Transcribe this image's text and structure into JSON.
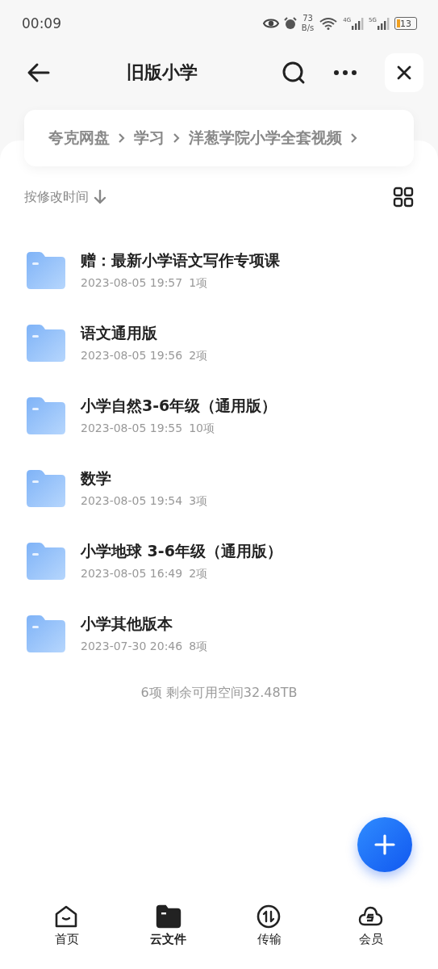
{
  "status_bar": {
    "time": "00:09",
    "net_speed": "73",
    "net_unit": "B/s",
    "sig1": "4G",
    "sig2": "5G",
    "battery": "13"
  },
  "header": {
    "title": "旧版小学"
  },
  "breadcrumb": [
    "夸克网盘",
    "学习",
    "洋葱学院小学全套视频"
  ],
  "sort": {
    "label": "按修改时间"
  },
  "files": [
    {
      "name": "赠：最新小学语文写作专项课",
      "date": "2023-08-05 19:57",
      "count": "1项"
    },
    {
      "name": "语文通用版",
      "date": "2023-08-05 19:56",
      "count": "2项"
    },
    {
      "name": "小学自然3-6年级（通用版）",
      "date": "2023-08-05 19:55",
      "count": "10项"
    },
    {
      "name": "数学",
      "date": "2023-08-05 19:54",
      "count": "3项"
    },
    {
      "name": "小学地球 3-6年级（通用版）",
      "date": "2023-08-05 16:49",
      "count": "2项"
    },
    {
      "name": "小学其他版本",
      "date": "2023-07-30 20:46",
      "count": "8项"
    }
  ],
  "summary": "6项 剩余可用空间32.48TB",
  "nav": [
    {
      "kind": "home",
      "label": "首页",
      "selected": false
    },
    {
      "kind": "files",
      "label": "云文件",
      "selected": true
    },
    {
      "kind": "transfer",
      "label": "传输",
      "selected": false
    },
    {
      "kind": "member",
      "label": "会员",
      "selected": false
    }
  ]
}
